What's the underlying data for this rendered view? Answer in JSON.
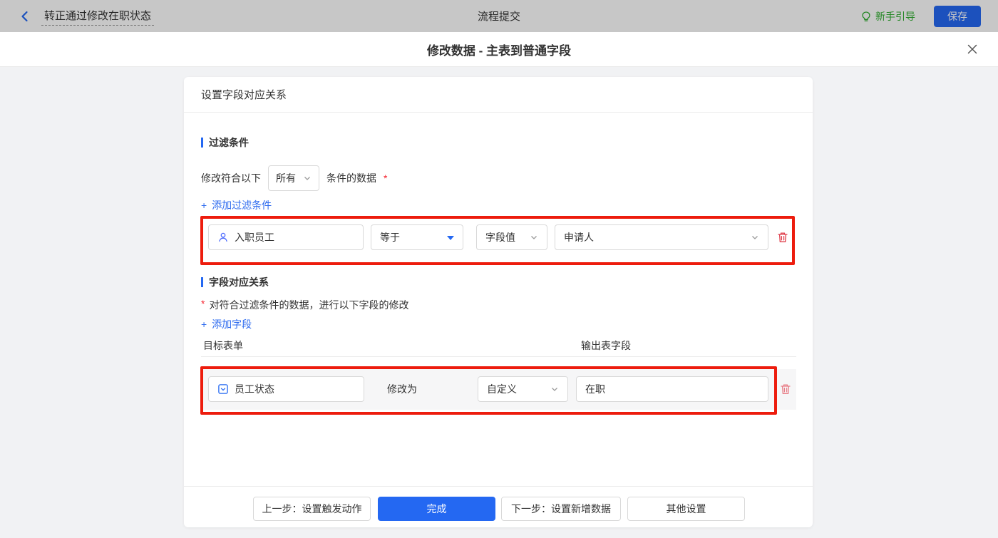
{
  "topbar": {
    "flow_name": "转正通过修改在职状态",
    "center_title": "流程提交",
    "guide_label": "新手引导",
    "save_label": "保存"
  },
  "modal": {
    "title": "修改数据 - 主表到普通字段",
    "panel_title": "设置字段对应关系"
  },
  "filter_section": {
    "title": "过滤条件",
    "condition_prefix": "修改符合以下",
    "condition_scope": "所有",
    "condition_suffix": "条件的数据",
    "required_mark": "*",
    "add_label": "添加过滤条件",
    "row": {
      "field": "入职员工",
      "operator": "等于",
      "value_type": "字段值",
      "value": "申请人"
    }
  },
  "mapping_section": {
    "title": "字段对应关系",
    "required_mark": "*",
    "description": "对符合过滤条件的数据，进行以下字段的修改",
    "add_label": "添加字段",
    "columns": {
      "target": "目标表单",
      "output": "输出表字段"
    },
    "row": {
      "field": "员工状态",
      "action_label": "修改为",
      "mode": "自定义",
      "value": "在职"
    }
  },
  "footer": {
    "prev": "上一步：设置触发动作",
    "done": "完成",
    "next": "下一步：设置新增数据",
    "other": "其他设置"
  },
  "icons": {
    "plus": "+"
  },
  "colors": {
    "accent_blue": "#2468f2",
    "link_blue": "#2e6bef",
    "annotation_red": "#ed1c0d",
    "danger_red": "#df3d4a",
    "guide_green": "#2fae2f",
    "required_red": "#f5222d",
    "topbar_dim": "rgba(0,0,0,0.22)"
  }
}
